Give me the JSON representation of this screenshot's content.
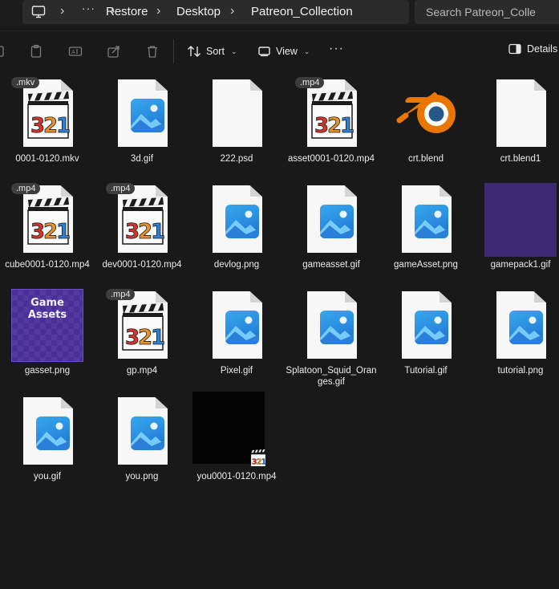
{
  "breadcrumb": {
    "more_label": "···",
    "items": [
      "Restore",
      "Desktop",
      "Patreon_Collection"
    ],
    "separator": ">"
  },
  "search": {
    "placeholder": "Search Patreon_Colle"
  },
  "toolbar": {
    "sort_label": "Sort",
    "view_label": "View",
    "more_label": "···",
    "details_label": "Details"
  },
  "files": [
    {
      "name": "0001-0120.mkv",
      "kind": "video",
      "badge": ".mkv"
    },
    {
      "name": "3d.gif",
      "kind": "image"
    },
    {
      "name": "222.psd",
      "kind": "blank"
    },
    {
      "name": "asset0001-0120.mp4",
      "kind": "video",
      "badge": ".mp4"
    },
    {
      "name": "crt.blend",
      "kind": "blender"
    },
    {
      "name": "crt.blend1",
      "kind": "blank"
    },
    {
      "name": "cube0001-0120.mp4",
      "kind": "video",
      "badge": ".mp4"
    },
    {
      "name": "dev0001-0120.mp4",
      "kind": "video",
      "badge": ".mp4"
    },
    {
      "name": "devlog.png",
      "kind": "image"
    },
    {
      "name": "gameasset.gif",
      "kind": "image"
    },
    {
      "name": "gameAsset.png",
      "kind": "image"
    },
    {
      "name": "gamepack1.gif",
      "kind": "purple-thumb"
    },
    {
      "name": "gasset.png",
      "kind": "gasset-thumb",
      "thumb_text": "Game\nAssets"
    },
    {
      "name": "gp.mp4",
      "kind": "video",
      "badge": ".mp4"
    },
    {
      "name": "Pixel.gif",
      "kind": "image"
    },
    {
      "name": "Splatoon_Squid_Oranges.gif",
      "kind": "image"
    },
    {
      "name": "Tutorial.gif",
      "kind": "image"
    },
    {
      "name": "tutorial.png",
      "kind": "image"
    },
    {
      "name": "you.gif",
      "kind": "image"
    },
    {
      "name": "you.png",
      "kind": "image"
    },
    {
      "name": "you0001-0120.mp4",
      "kind": "video-black"
    }
  ],
  "colors": {
    "background": "#191919",
    "image_icon_blue": "#2a8be0",
    "blender_orange": "#ea7600",
    "blender_blue": "#265787"
  }
}
